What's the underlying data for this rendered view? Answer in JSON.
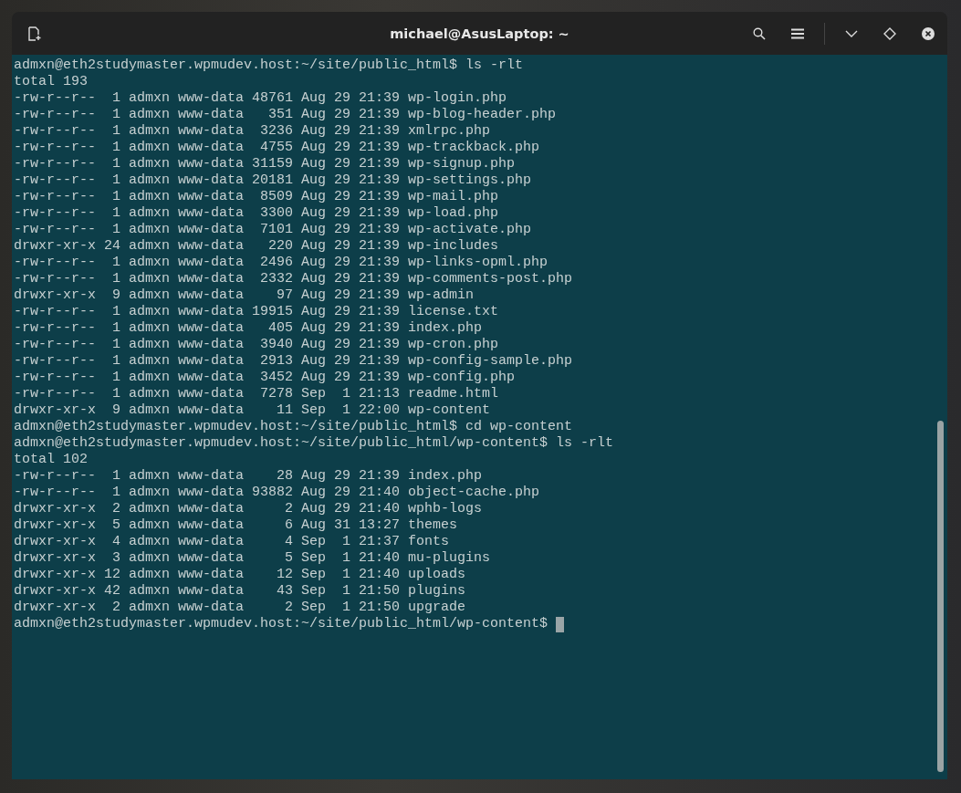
{
  "window": {
    "title": "michael@AsusLaptop: ~"
  },
  "terminal": {
    "lines": [
      "admxn@eth2studymaster.wpmudev.host:~/site/public_html$ ls -rlt",
      "total 193",
      "-rw-r--r--  1 admxn www-data 48761 Aug 29 21:39 wp-login.php",
      "-rw-r--r--  1 admxn www-data   351 Aug 29 21:39 wp-blog-header.php",
      "-rw-r--r--  1 admxn www-data  3236 Aug 29 21:39 xmlrpc.php",
      "-rw-r--r--  1 admxn www-data  4755 Aug 29 21:39 wp-trackback.php",
      "-rw-r--r--  1 admxn www-data 31159 Aug 29 21:39 wp-signup.php",
      "-rw-r--r--  1 admxn www-data 20181 Aug 29 21:39 wp-settings.php",
      "-rw-r--r--  1 admxn www-data  8509 Aug 29 21:39 wp-mail.php",
      "-rw-r--r--  1 admxn www-data  3300 Aug 29 21:39 wp-load.php",
      "-rw-r--r--  1 admxn www-data  7101 Aug 29 21:39 wp-activate.php",
      "drwxr-xr-x 24 admxn www-data   220 Aug 29 21:39 wp-includes",
      "-rw-r--r--  1 admxn www-data  2496 Aug 29 21:39 wp-links-opml.php",
      "-rw-r--r--  1 admxn www-data  2332 Aug 29 21:39 wp-comments-post.php",
      "drwxr-xr-x  9 admxn www-data    97 Aug 29 21:39 wp-admin",
      "-rw-r--r--  1 admxn www-data 19915 Aug 29 21:39 license.txt",
      "-rw-r--r--  1 admxn www-data   405 Aug 29 21:39 index.php",
      "-rw-r--r--  1 admxn www-data  3940 Aug 29 21:39 wp-cron.php",
      "-rw-r--r--  1 admxn www-data  2913 Aug 29 21:39 wp-config-sample.php",
      "-rw-r--r--  1 admxn www-data  3452 Aug 29 21:39 wp-config.php",
      "-rw-r--r--  1 admxn www-data  7278 Sep  1 21:13 readme.html",
      "drwxr-xr-x  9 admxn www-data    11 Sep  1 22:00 wp-content",
      "admxn@eth2studymaster.wpmudev.host:~/site/public_html$ cd wp-content",
      "admxn@eth2studymaster.wpmudev.host:~/site/public_html/wp-content$ ls -rlt",
      "total 102",
      "-rw-r--r--  1 admxn www-data    28 Aug 29 21:39 index.php",
      "-rw-r--r--  1 admxn www-data 93882 Aug 29 21:40 object-cache.php",
      "drwxr-xr-x  2 admxn www-data     2 Aug 29 21:40 wphb-logs",
      "drwxr-xr-x  5 admxn www-data     6 Aug 31 13:27 themes",
      "drwxr-xr-x  4 admxn www-data     4 Sep  1 21:37 fonts",
      "drwxr-xr-x  3 admxn www-data     5 Sep  1 21:40 mu-plugins",
      "drwxr-xr-x 12 admxn www-data    12 Sep  1 21:40 uploads",
      "drwxr-xr-x 42 admxn www-data    43 Sep  1 21:50 plugins",
      "drwxr-xr-x  2 admxn www-data     2 Sep  1 21:50 upgrade"
    ],
    "prompt": "admxn@eth2studymaster.wpmudev.host:~/site/public_html/wp-content$"
  }
}
